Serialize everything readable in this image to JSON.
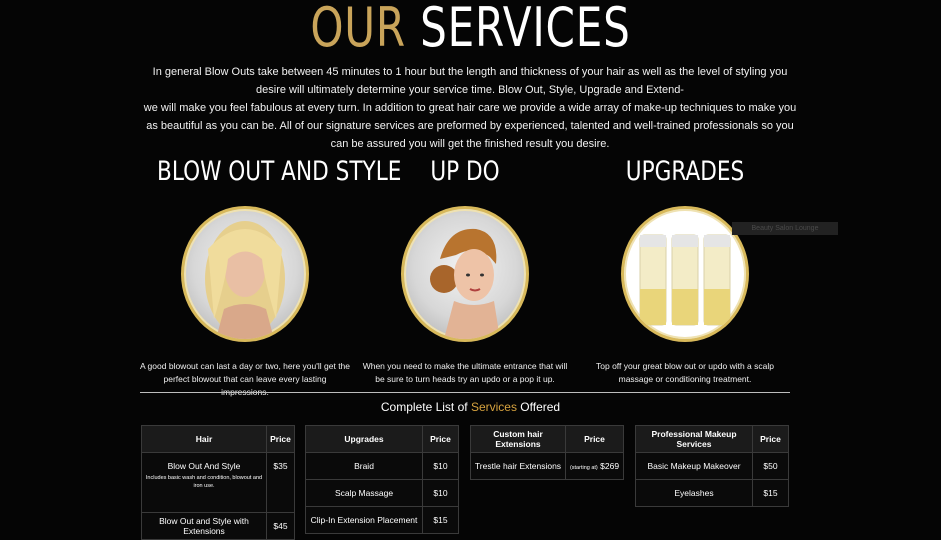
{
  "header": {
    "title_our": "OUR",
    "title_services": "SERVICES"
  },
  "intro": {
    "line1": "In general Blow Outs take between 45 minutes to 1 hour but the length and thickness of your hair as well as the level of styling you desire will ultimately determine your service time. Blow Out, Style, Upgrade and Extend-",
    "line2": "we will make you feel fabulous at every turn. In addition to great hair care we provide a wide array of make-up techniques to make you as beautiful as you can be. All of our signature services are preformed by experienced, talented and well-trained professionals so you can be assured you will get the finished result you desire."
  },
  "services": [
    {
      "title": "BLOW OUT AND STYLE",
      "desc": "A good blowout can last a day or two, here you'll get the perfect blowout that can leave every lasting impressions."
    },
    {
      "title": "UP DO",
      "desc": "When you need to make the ultimate entrance that will be sure to turn heads try an updo or a pop it up."
    },
    {
      "title": "UPGRADES",
      "desc": "Top off your great blow out or updo with a scalp massage or conditioning treatment."
    }
  ],
  "overlay_tag": "Beauty Salon Lounge",
  "list": {
    "prefix": "Complete List of ",
    "highlight": "Services",
    "suffix": " Offered"
  },
  "tables": {
    "hair": {
      "headers": [
        "Hair",
        "Price"
      ],
      "rows": [
        {
          "name": "Blow Out And Style",
          "note": "Includes basic wash and condition, blowout and iron use.",
          "price": "$35"
        },
        {
          "name": "Blow Out and Style with Extensions",
          "price": "$45"
        }
      ]
    },
    "upgrades": {
      "headers": [
        "Upgrades",
        "Price"
      ],
      "rows": [
        {
          "name": "Braid",
          "price": "$10"
        },
        {
          "name": "Scalp Massage",
          "price": "$10"
        },
        {
          "name": "Clip-In Extension Placement",
          "price": "$15"
        }
      ]
    },
    "extensions": {
      "headers": [
        "Custom hair Extensions",
        "Price"
      ],
      "rows": [
        {
          "name": "Trestle hair Extensions",
          "note": "(starting at)",
          "price": "$269"
        }
      ]
    },
    "makeup": {
      "headers": [
        "Professional Makeup Services",
        "Price"
      ],
      "rows": [
        {
          "name": "Basic Makeup Makeover",
          "price": "$50"
        },
        {
          "name": "Eyelashes",
          "price": "$15"
        }
      ]
    }
  },
  "colors": {
    "gold": "#c9a45a",
    "highlight": "#d7a33f",
    "background": "#050505"
  }
}
